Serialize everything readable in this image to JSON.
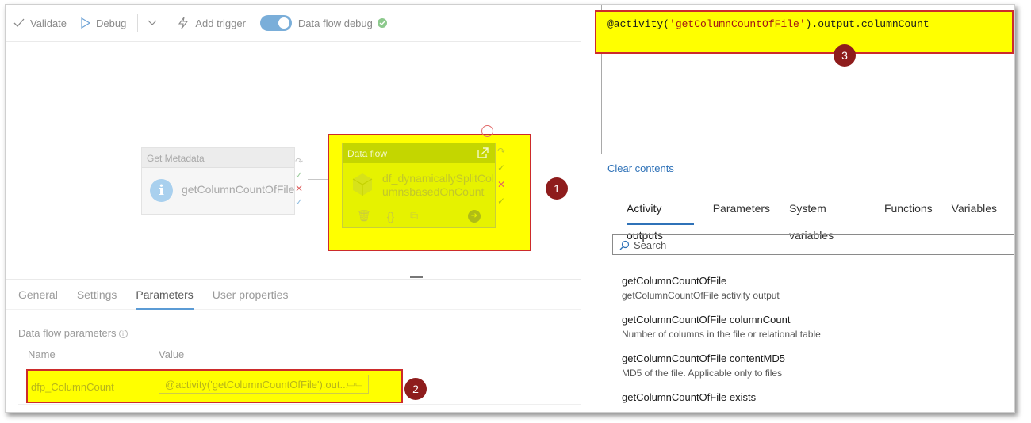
{
  "toolbar": {
    "validate": "Validate",
    "debug": "Debug",
    "add_trigger": "Add trigger",
    "data_flow_debug": "Data flow debug"
  },
  "canvas": {
    "get_metadata": {
      "header": "Get Metadata",
      "name": "getColumnCountOfFile"
    },
    "data_flow": {
      "header": "Data flow",
      "name": "df_dynamicallySplitColumnsbasedOnCount"
    }
  },
  "badges": {
    "one": "1",
    "two": "2",
    "three": "3"
  },
  "bottom": {
    "tabs": [
      {
        "label": "General"
      },
      {
        "label": "Settings"
      },
      {
        "label": "Parameters"
      },
      {
        "label": "User properties"
      }
    ],
    "section_title": "Data flow parameters",
    "col_name": "Name",
    "col_value": "Value",
    "param": {
      "name": "dfp_ColumnCount",
      "value": "@activity('getColumnCountOfFile').out..."
    }
  },
  "expression": {
    "prefix": "@activity(",
    "string": "'getColumnCountOfFile'",
    "suffix": ").output.columnCount"
  },
  "right": {
    "clear": "Clear contents",
    "tabs": [
      {
        "label": "Activity outputs"
      },
      {
        "label": "Parameters"
      },
      {
        "label": "System variables"
      },
      {
        "label": "Functions"
      },
      {
        "label": "Variables"
      }
    ],
    "search_placeholder": "Search",
    "outputs": [
      {
        "title": "getColumnCountOfFile",
        "desc": "getColumnCountOfFile activity output"
      },
      {
        "title": "getColumnCountOfFile columnCount",
        "desc": "Number of columns in the file or relational table"
      },
      {
        "title": "getColumnCountOfFile contentMD5",
        "desc": "MD5 of the file. Applicable only to files"
      },
      {
        "title": "getColumnCountOfFile exists",
        "desc": ""
      }
    ]
  },
  "colors": {
    "highlight": "#ffff00",
    "annotation_border": "#cc2b2b",
    "badge": "#8e1c1c",
    "accent": "#2f72b8"
  }
}
